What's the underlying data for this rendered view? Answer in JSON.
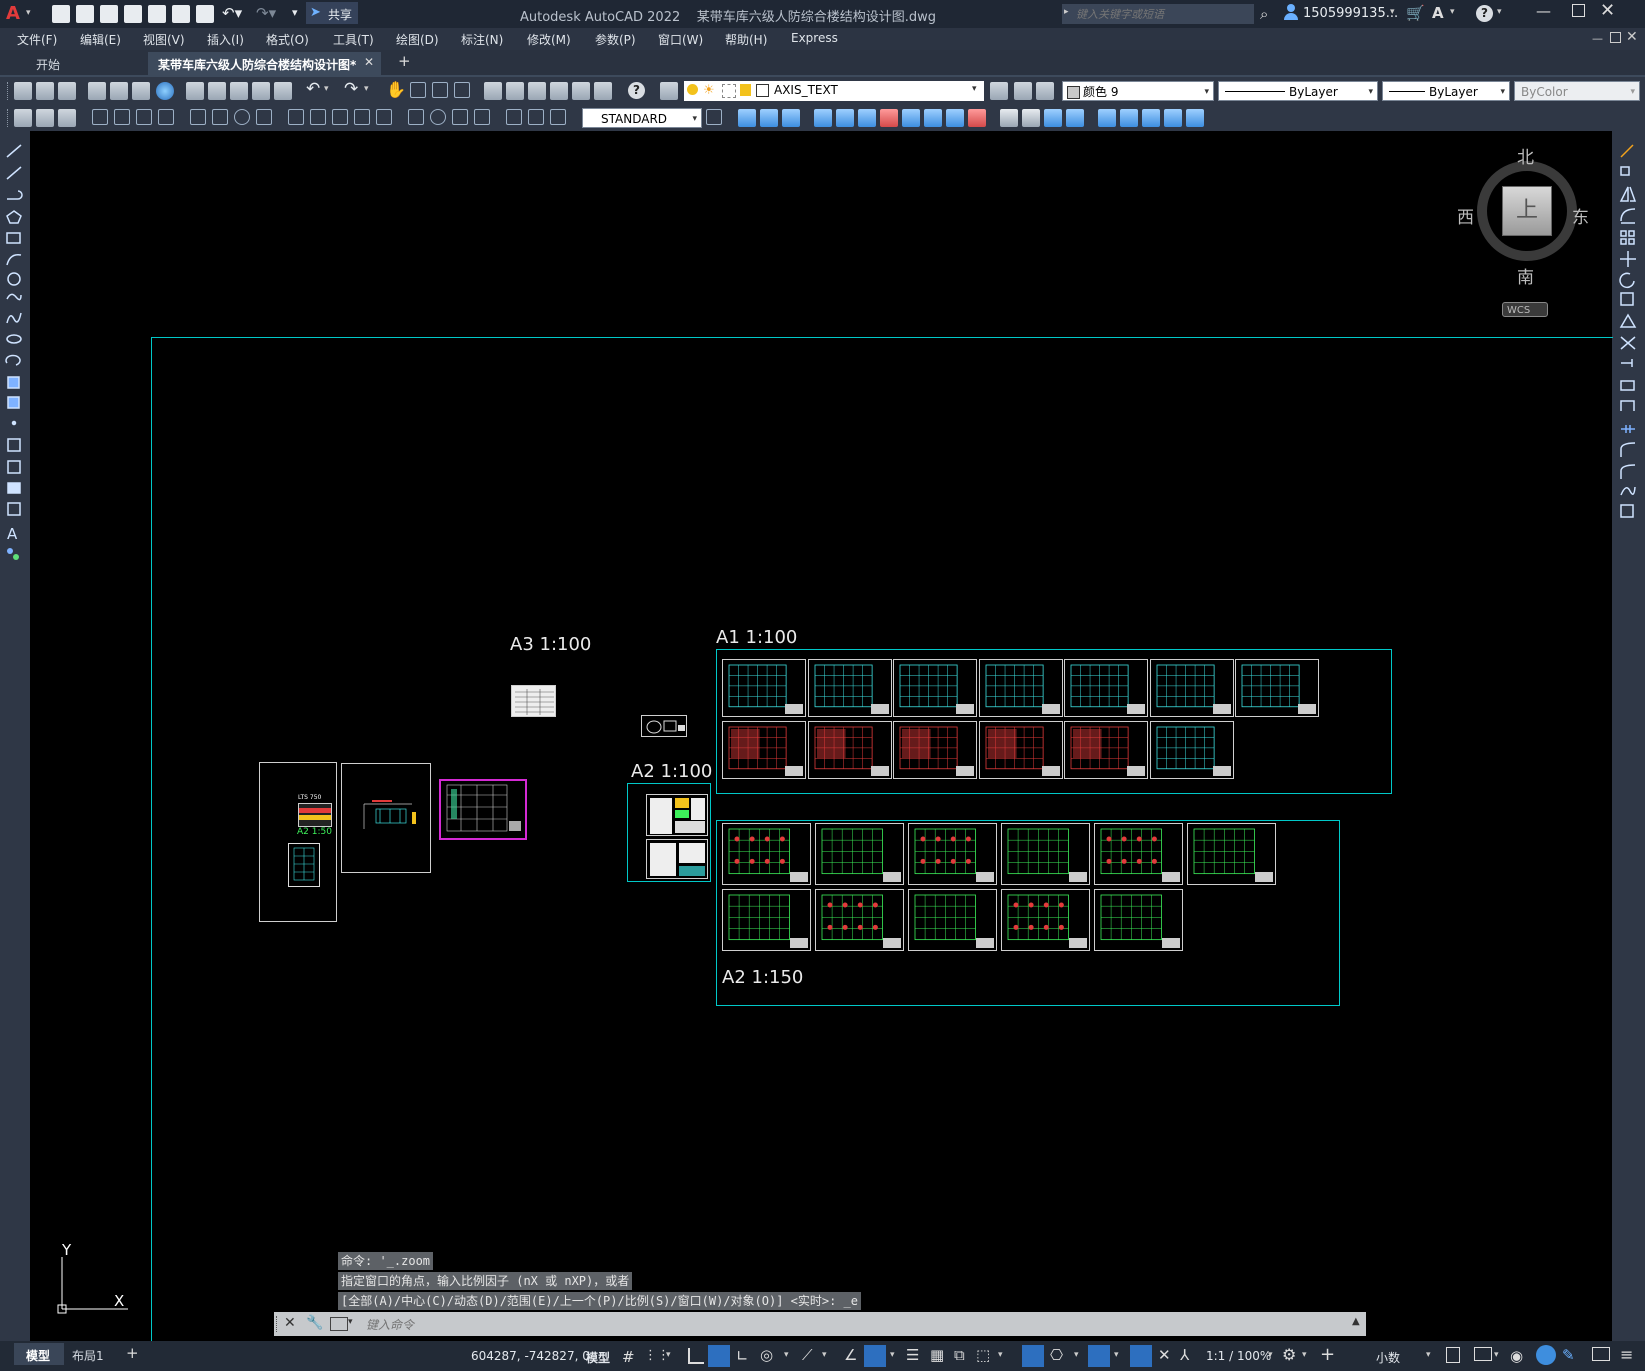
{
  "window": {
    "title": "Autodesk AutoCAD 2022    某带车库六级人防综合楼结构设计图.dwg",
    "share_label": "共享",
    "search_placeholder": "键入关键字或短语",
    "user": "1505999135...",
    "help": "?"
  },
  "menu": [
    "文件(F)",
    "编辑(E)",
    "视图(V)",
    "插入(I)",
    "格式(O)",
    "工具(T)",
    "绘图(D)",
    "标注(N)",
    "修改(M)",
    "参数(P)",
    "窗口(W)",
    "帮助(H)",
    "Express"
  ],
  "tabs": {
    "start": "开始",
    "active": "某带车库六级人防综合楼结构设计图*",
    "add": "+"
  },
  "toolbar": {
    "layer_value": "AXIS_TEXT",
    "color_value": "颜色 9",
    "linetype_value": "ByLayer",
    "lineweight_value": "ByLayer",
    "plotstyle_value": "ByColor",
    "textstyle_value": "STANDARD"
  },
  "viewcube": {
    "north": "北",
    "south": "南",
    "east": "东",
    "west": "西",
    "face": "上",
    "wcs": "WCS"
  },
  "drawing": {
    "label_a3": "A3  1:100",
    "label_a1": "A1  1:100",
    "label_a2_100": "A2  1:100",
    "label_a2_150": "A2  1:150",
    "small_lts": "LTS  750",
    "small_a2": "A2 1:50"
  },
  "ucs": {
    "x": "X",
    "y": "Y"
  },
  "command": {
    "line1": "命令: '_.zoom",
    "line2": "指定窗口的角点，输入比例因子 (nX 或 nXP)，或者",
    "line3": "[全部(A)/中心(C)/动态(D)/范围(E)/上一个(P)/比例(S)/窗口(W)/对象(O)] <实时>: _e",
    "placeholder": "键入命令"
  },
  "status": {
    "model_tab": "模型",
    "layout_tab": "布局1",
    "add_tab": "+",
    "coords": "604287, -742827, 0",
    "mode": "模型",
    "scale": "1:1 / 100%",
    "units": "小数"
  },
  "colors": {
    "canvas": "#000000",
    "limits_line": "#00c8c8",
    "ui_dark": "#2f3746",
    "accent_red": "#e23b3b"
  }
}
